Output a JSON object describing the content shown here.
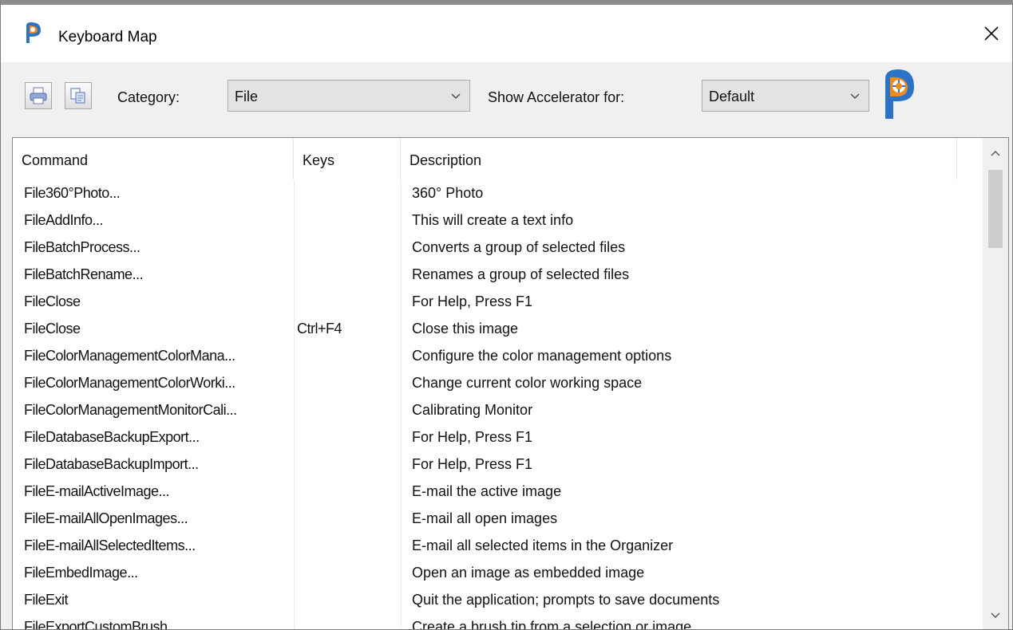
{
  "window": {
    "title": "Keyboard Map"
  },
  "toolbar": {
    "category_label": "Category:",
    "category_value": "File",
    "accelerator_label": "Show Accelerator for:",
    "accelerator_value": "Default"
  },
  "icons": {
    "app": "paintshop-pro-icon",
    "close": "close-icon",
    "print": "print-icon",
    "copy": "copy-icon",
    "dropdown": "chevron-down-icon",
    "logo": "paintshop-pro-logo"
  },
  "colors": {
    "logo_blue": "#2a73c7",
    "logo_orange": "#f08a1d"
  },
  "table": {
    "columns": [
      "Command",
      "Keys",
      "Description"
    ],
    "rows": [
      {
        "command": "File360°Photo...",
        "keys": "",
        "description": "360° Photo"
      },
      {
        "command": "FileAddInfo...",
        "keys": "",
        "description": "This will create a text info"
      },
      {
        "command": "FileBatchProcess...",
        "keys": "",
        "description": "Converts a group of selected files"
      },
      {
        "command": "FileBatchRename...",
        "keys": "",
        "description": "Renames a group of selected files"
      },
      {
        "command": "FileClose",
        "keys": "",
        "description": "For Help, Press F1"
      },
      {
        "command": "FileClose",
        "keys": "Ctrl+F4",
        "description": "Close this image"
      },
      {
        "command": "FileColorManagementColorMana...",
        "keys": "",
        "description": "Configure the color management options"
      },
      {
        "command": "FileColorManagementColorWorki...",
        "keys": "",
        "description": "Change current color working space"
      },
      {
        "command": "FileColorManagementMonitorCali...",
        "keys": "",
        "description": "Calibrating Monitor"
      },
      {
        "command": "FileDatabaseBackupExport...",
        "keys": "",
        "description": "For Help, Press F1"
      },
      {
        "command": "FileDatabaseBackupImport...",
        "keys": "",
        "description": "For Help, Press F1"
      },
      {
        "command": "FileE-mailActiveImage...",
        "keys": "",
        "description": "E-mail the active image"
      },
      {
        "command": "FileE-mailAllOpenImages...",
        "keys": "",
        "description": "E-mail all open images"
      },
      {
        "command": "FileE-mailAllSelectedItems...",
        "keys": "",
        "description": "E-mail all selected items in the Organizer"
      },
      {
        "command": "FileEmbedImage...",
        "keys": "",
        "description": "Open an image as embedded image"
      },
      {
        "command": "FileExit",
        "keys": "",
        "description": "Quit the application; prompts to save documents"
      },
      {
        "command": "FileExportCustomBrush...",
        "keys": "",
        "description": "Create a brush tip from a selection or image"
      }
    ]
  }
}
